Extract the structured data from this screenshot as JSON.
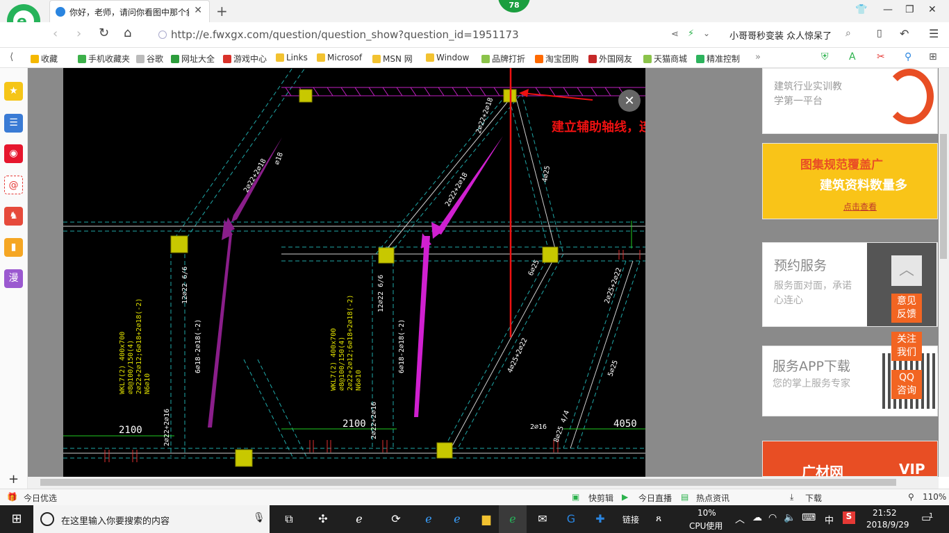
{
  "browser": {
    "tab_title": "你好，老师，请问你看图中那个斜",
    "notification_count": "78",
    "url": "http://e.fwxgx.com/question/question_show?question_id=1951173",
    "news_headline": "小哥哥秒变装 众人惊呆了"
  },
  "bookmarks": [
    {
      "label": "收藏",
      "color": "#f5b800"
    },
    {
      "label": "手机收藏夹",
      "color": "#3cb04a"
    },
    {
      "label": "谷歌",
      "color": "#bbbbbb"
    },
    {
      "label": "网址大全",
      "color": "#2d9d3c"
    },
    {
      "label": "游戏中心",
      "color": "#d9322a"
    },
    {
      "label": "Links",
      "color": "#f2c230"
    },
    {
      "label": "Microsof",
      "color": "#f2c230"
    },
    {
      "label": "MSN 网",
      "color": "#f2c230"
    },
    {
      "label": "Window",
      "color": "#f2c230"
    },
    {
      "label": "品牌打折",
      "color": "#8bc34a"
    },
    {
      "label": "淘宝团购",
      "color": "#ff6a00"
    },
    {
      "label": "外国网友",
      "color": "#c62828"
    },
    {
      "label": "天猫商城",
      "color": "#8bc34a"
    },
    {
      "label": "精准控制",
      "color": "#2db35d"
    }
  ],
  "sidebar": [
    {
      "icon": "star-icon",
      "glyph": "★",
      "color": "#f5c518"
    },
    {
      "icon": "news-icon",
      "glyph": "☰",
      "color": "#3a7bd5"
    },
    {
      "icon": "weibo-icon",
      "glyph": "◉",
      "color": "#e6162d"
    },
    {
      "icon": "mail-icon",
      "glyph": "@",
      "color": "#ffffff"
    },
    {
      "icon": "game-icon",
      "glyph": "♞",
      "color": "#e64a3b"
    },
    {
      "icon": "book-icon",
      "glyph": "▮",
      "color": "#f5a623"
    },
    {
      "icon": "comic-icon",
      "glyph": "漫",
      "color": "#9b59d0"
    }
  ],
  "cad": {
    "annotation": "建立辅助轴线，连续绘制",
    "dims": [
      "2100",
      "2100",
      "4050"
    ],
    "labels": [
      "2⌀22+2⌀16",
      "12⌀22 6/6",
      "6⌀18-2⌀18(-2)",
      "WKL7(2) 400x700",
      "⌀8@100/150(4)",
      "2⌀22+2⌀12;6⌀18+2⌀18(-2)",
      "N6⌀10",
      "4⌀25+2⌀22",
      "2⌀25+2⌀22",
      "4⌀25",
      "6⌀25",
      "5⌀25",
      "2⌀16",
      "8⌀25 4/4",
      "2⌀22+2⌀16",
      "2⌀22+2⌀18",
      "⌀18"
    ]
  },
  "right_panels": {
    "ad1_desc": "建筑行业实训教\n学第一平台",
    "ad2_line1": "图集规范覆盖广",
    "ad2_line2": "建筑资料数量多",
    "ad2_link": "点击查看",
    "service_title": "预约服务",
    "service_desc": "服务面对面，承诺心连心",
    "app_title": "服务APP下载",
    "app_desc": "您的掌上服务专家",
    "banner": "广材网",
    "vip": "VIP"
  },
  "float_buttons": [
    "意见反馈",
    "关注我们",
    "QQ咨询"
  ],
  "status": {
    "left": "今日优选",
    "items": [
      "快剪辑",
      "今日直播",
      "热点资讯",
      "下载"
    ],
    "zoom": "110%"
  },
  "taskbar": {
    "search_placeholder": "在这里输入你要搜索的内容",
    "links": "链接",
    "cpu_percent": "10%",
    "cpu_label": "CPU使用",
    "ime": "中",
    "time": "21:52",
    "date": "2018/9/29",
    "notif": "1"
  }
}
